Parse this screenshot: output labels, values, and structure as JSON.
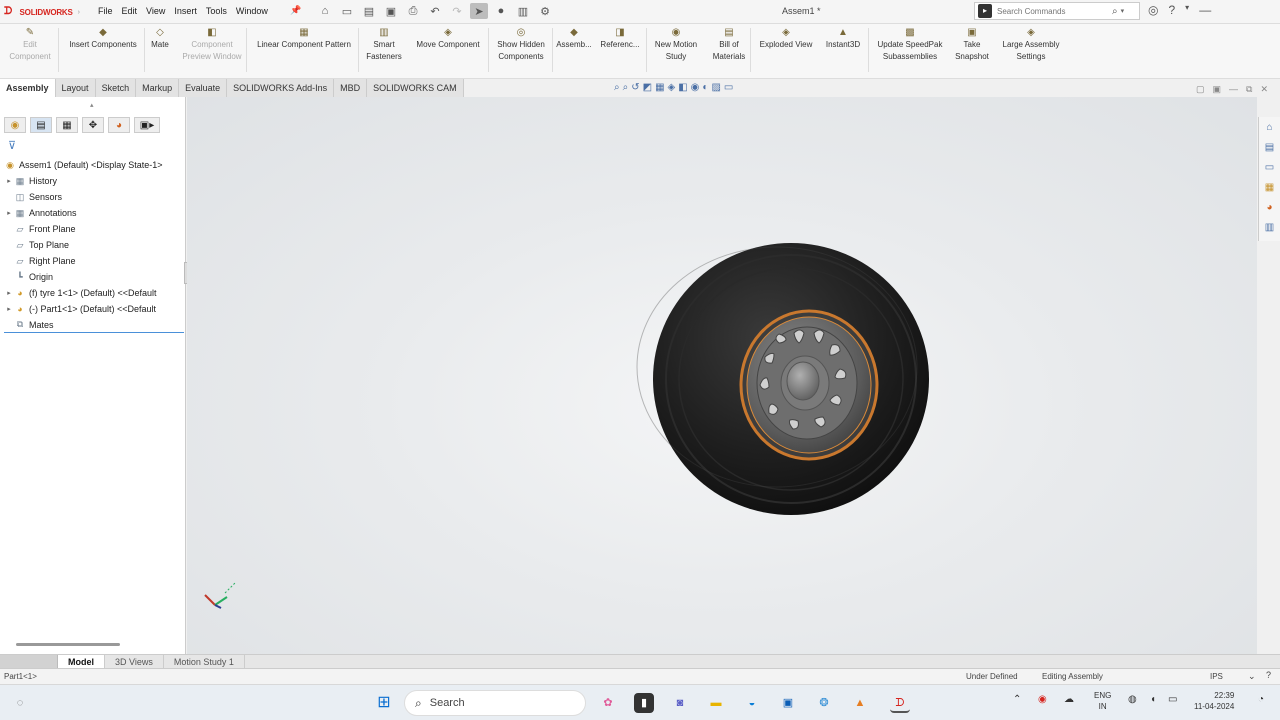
{
  "titlebar": {
    "brand": "SOLIDWORKS",
    "menu": [
      "File",
      "Edit",
      "View",
      "Insert",
      "Tools",
      "Window"
    ],
    "doc_title": "Assem1 *",
    "search_placeholder": "Search Commands"
  },
  "ribbon": {
    "buttons": [
      {
        "label": "Edit\nComponent",
        "disabled": true
      },
      {
        "label": "Insert Components",
        "disabled": false
      },
      {
        "label": "Mate",
        "disabled": false
      },
      {
        "label": "Component\nPreview Window",
        "disabled": true
      },
      {
        "label": "Linear Component Pattern",
        "disabled": false
      },
      {
        "label": "Smart\nFasteners",
        "disabled": false
      },
      {
        "label": "Move Component",
        "disabled": false
      },
      {
        "label": "Show Hidden\nComponents",
        "disabled": false
      },
      {
        "label": "Assemb...",
        "disabled": false
      },
      {
        "label": "Referenc...",
        "disabled": false
      },
      {
        "label": "New Motion\nStudy",
        "disabled": false
      },
      {
        "label": "Bill of\nMaterials",
        "disabled": false
      },
      {
        "label": "Exploded View",
        "disabled": false
      },
      {
        "label": "Instant3D",
        "disabled": false
      },
      {
        "label": "Update SpeedPak\nSubassemblies",
        "disabled": false
      },
      {
        "label": "Take\nSnapshot",
        "disabled": false
      },
      {
        "label": "Large Assembly\nSettings",
        "disabled": false
      }
    ]
  },
  "tabs": [
    "Assembly",
    "Layout",
    "Sketch",
    "Markup",
    "Evaluate",
    "SOLIDWORKS Add-Ins",
    "MBD",
    "SOLIDWORKS CAM"
  ],
  "tree": {
    "root": "Assem1 (Default) <Display State-1>",
    "items": [
      {
        "label": "History",
        "expandable": true,
        "icon": "folder-icon"
      },
      {
        "label": "Sensors",
        "expandable": false,
        "icon": "sensor-icon"
      },
      {
        "label": "Annotations",
        "expandable": true,
        "icon": "annotation-icon"
      },
      {
        "label": "Front Plane",
        "expandable": false,
        "icon": "plane-icon"
      },
      {
        "label": "Top Plane",
        "expandable": false,
        "icon": "plane-icon"
      },
      {
        "label": "Right Plane",
        "expandable": false,
        "icon": "plane-icon"
      },
      {
        "label": "Origin",
        "expandable": false,
        "icon": "origin-icon"
      },
      {
        "label": "(f) tyre 1<1> (Default) <<Default",
        "expandable": true,
        "icon": "part-icon"
      },
      {
        "label": "(-) Part1<1> (Default) <<Default",
        "expandable": true,
        "icon": "part-icon"
      },
      {
        "label": "Mates",
        "expandable": false,
        "icon": "mates-icon"
      }
    ]
  },
  "bottom_tabs": [
    "Model",
    "3D Views",
    "Motion Study 1"
  ],
  "status": {
    "selection": "Part1<1>",
    "definition": "Under Defined",
    "mode": "Editing Assembly",
    "units": "IPS"
  },
  "taskbar": {
    "search_label": "Search",
    "lang_top": "ENG",
    "lang_bottom": "IN",
    "time": "22:39",
    "date": "11-04-2024"
  }
}
